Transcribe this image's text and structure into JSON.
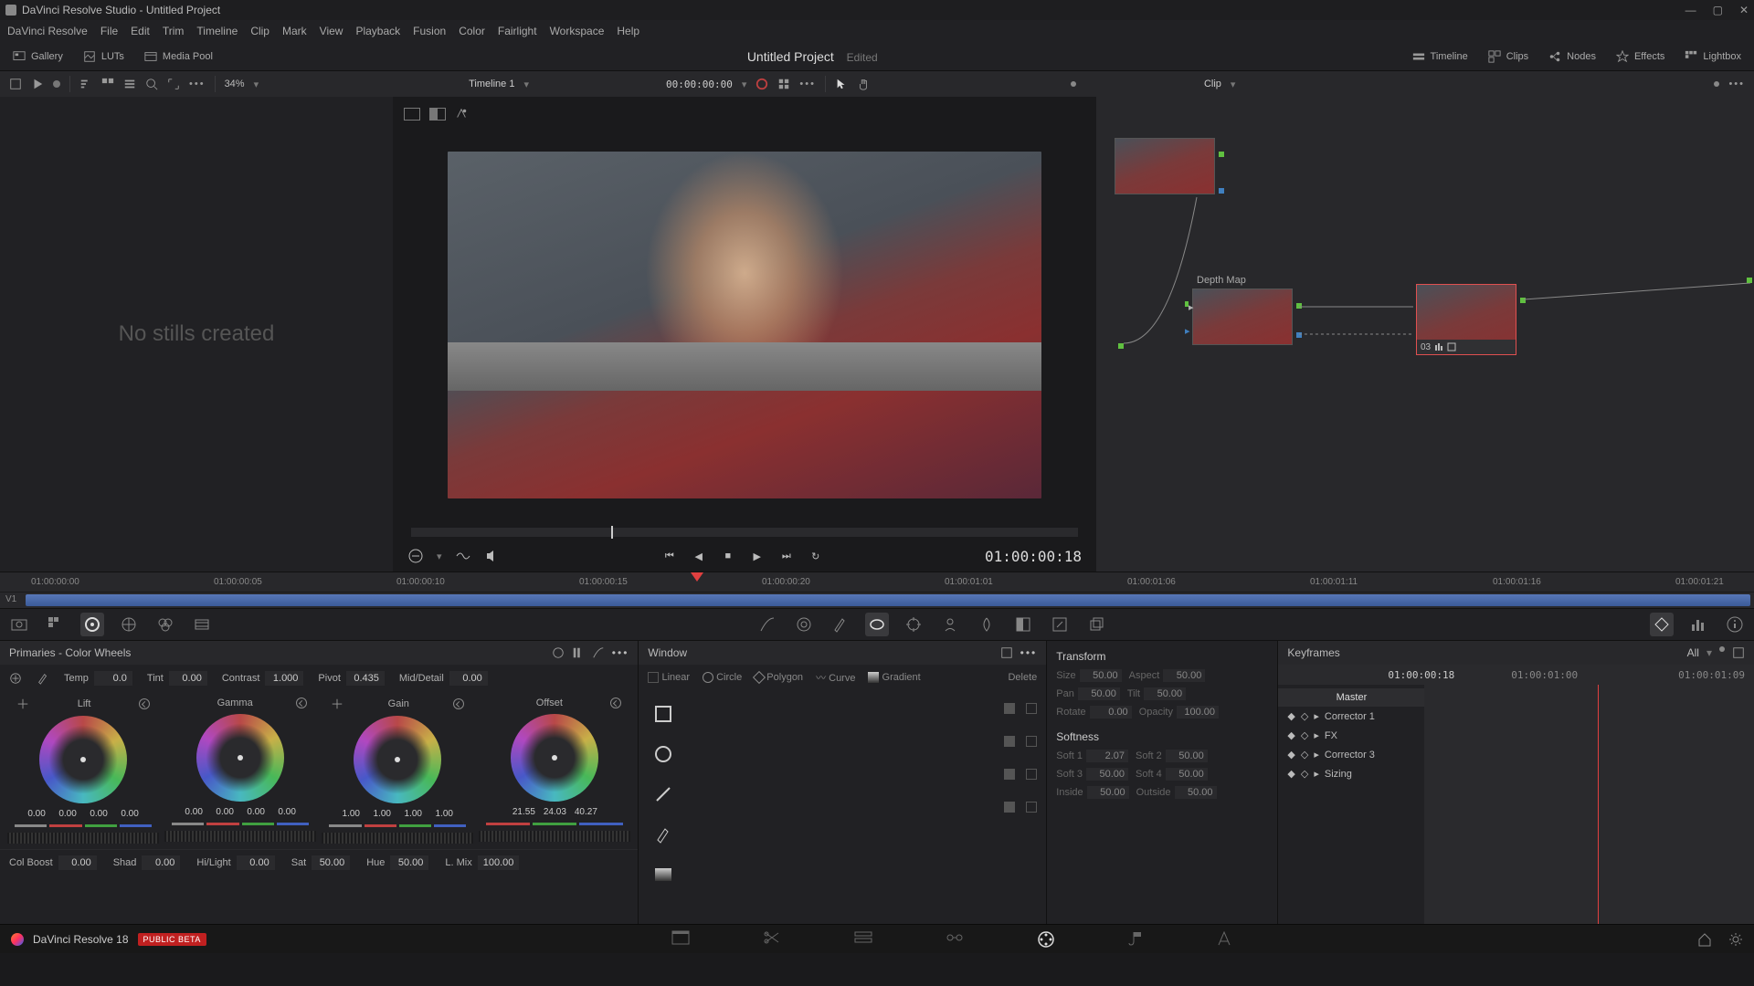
{
  "titlebar": {
    "title": "DaVinci Resolve Studio - Untitled Project"
  },
  "menu": [
    "DaVinci Resolve",
    "File",
    "Edit",
    "Trim",
    "Timeline",
    "Clip",
    "Mark",
    "View",
    "Playback",
    "Fusion",
    "Color",
    "Fairlight",
    "Workspace",
    "Help"
  ],
  "toolbar": {
    "gallery": "Gallery",
    "luts": "LUTs",
    "mediapool": "Media Pool",
    "project": "Untitled Project",
    "edited": "Edited",
    "timeline": "Timeline",
    "clips": "Clips",
    "nodes": "Nodes",
    "effects": "Effects",
    "lightbox": "Lightbox"
  },
  "subbar": {
    "zoom": "34%",
    "timeline": "Timeline 1",
    "tc": "00:00:00:00",
    "clip": "Clip"
  },
  "gallery": {
    "empty": "No stills created"
  },
  "transport": {
    "tc": "01:00:00:18"
  },
  "nodes": {
    "depthmap": "Depth Map",
    "n3": "03"
  },
  "ruler": [
    "01:00:00:00",
    "01:00:00:05",
    "01:00:00:10",
    "01:00:00:15",
    "01:00:00:20",
    "01:00:01:01",
    "01:00:01:06",
    "01:00:01:11",
    "01:00:01:16",
    "01:00:01:21"
  ],
  "track": {
    "label": "V1"
  },
  "primaries": {
    "title": "Primaries - Color Wheels",
    "temp": {
      "label": "Temp",
      "val": "0.0"
    },
    "tint": {
      "label": "Tint",
      "val": "0.00"
    },
    "contrast": {
      "label": "Contrast",
      "val": "1.000"
    },
    "pivot": {
      "label": "Pivot",
      "val": "0.435"
    },
    "middetail": {
      "label": "Mid/Detail",
      "val": "0.00"
    },
    "wheels": [
      {
        "name": "Lift",
        "vals": [
          "0.00",
          "0.00",
          "0.00",
          "0.00"
        ]
      },
      {
        "name": "Gamma",
        "vals": [
          "0.00",
          "0.00",
          "0.00",
          "0.00"
        ]
      },
      {
        "name": "Gain",
        "vals": [
          "1.00",
          "1.00",
          "1.00",
          "1.00"
        ]
      },
      {
        "name": "Offset",
        "vals": [
          "21.55",
          "24.03",
          "40.27"
        ]
      }
    ],
    "colboost": {
      "label": "Col Boost",
      "val": "0.00"
    },
    "shad": {
      "label": "Shad",
      "val": "0.00"
    },
    "hilight": {
      "label": "Hi/Light",
      "val": "0.00"
    },
    "sat": {
      "label": "Sat",
      "val": "50.00"
    },
    "hue": {
      "label": "Hue",
      "val": "50.00"
    },
    "lmix": {
      "label": "L. Mix",
      "val": "100.00"
    }
  },
  "window": {
    "title": "Window",
    "tabs": {
      "linear": "Linear",
      "circle": "Circle",
      "polygon": "Polygon",
      "curve": "Curve",
      "gradient": "Gradient",
      "delete": "Delete"
    }
  },
  "transform": {
    "title": "Transform",
    "size": {
      "l": "Size",
      "v": "50.00"
    },
    "aspect": {
      "l": "Aspect",
      "v": "50.00"
    },
    "pan": {
      "l": "Pan",
      "v": "50.00"
    },
    "tilt": {
      "l": "Tilt",
      "v": "50.00"
    },
    "rotate": {
      "l": "Rotate",
      "v": "0.00"
    },
    "opacity": {
      "l": "Opacity",
      "v": "100.00"
    },
    "softness": "Softness",
    "soft1": {
      "l": "Soft 1",
      "v": "2.07"
    },
    "soft2": {
      "l": "Soft 2",
      "v": "50.00"
    },
    "soft3": {
      "l": "Soft 3",
      "v": "50.00"
    },
    "soft4": {
      "l": "Soft 4",
      "v": "50.00"
    },
    "inside": {
      "l": "Inside",
      "v": "50.00"
    },
    "outside": {
      "l": "Outside",
      "v": "50.00"
    }
  },
  "keyframes": {
    "title": "Keyframes",
    "all": "All",
    "tc1": "01:00:00:18",
    "tc2": "01:00:01:00",
    "tc3": "01:00:01:09",
    "master": "Master",
    "items": [
      "Corrector 1",
      "FX",
      "Corrector 3",
      "Sizing"
    ]
  },
  "pagebar": {
    "brand": "DaVinci Resolve 18",
    "badge": "PUBLIC BETA"
  }
}
